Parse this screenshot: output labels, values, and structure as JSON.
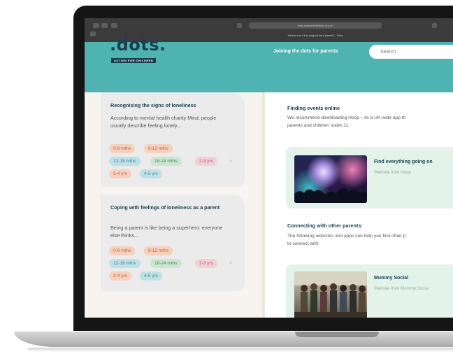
{
  "browser": {
    "url": "dots.actionforchildren.org.uk",
    "tab_title": "Where can I find support as a parent? - Dots"
  },
  "header": {
    "logo": ".dots.",
    "logo_sub": "ACTION FOR CHILDREN",
    "tagline": "Joining the dots for parents",
    "search_placeholder": "Search"
  },
  "cards": [
    {
      "title": "Recognising the signs of loneliness",
      "description": "According to mental health charity Mind, people usually describe feeling lonely...",
      "tags": [
        "0-6 mths",
        "6-12 mths",
        "12-18 mths",
        "18-24 mths",
        "2-3 yrs",
        "3-4 yrs",
        "4-5 yrs"
      ]
    },
    {
      "title": "Coping with feelings of loneliness as a parent",
      "description": "Being a parent is like being a superhero: everyone else thinks...",
      "tags": [
        "0-6 mths",
        "6-12 mths",
        "12-18 mths",
        "18-24 mths",
        "2-3 yrs",
        "3-4 yrs",
        "4-5 yrs"
      ]
    }
  ],
  "arrow_glyph": "↗",
  "sections": [
    {
      "title": "Finding events online",
      "text_line1": "We recommend downloading Hoop – its a UK-wide app th",
      "text_line2": "parents and children under 11.",
      "resource": {
        "title": "Find everything going on",
        "subtitle": "Website from Hoop"
      }
    },
    {
      "title": "Connecting with other parents:",
      "text_line1": "The following websites and apps can help you find other p",
      "text_line2": "to connect with:",
      "resource": {
        "title": "Mummy Social",
        "subtitle": "Website from Mummy Socia"
      }
    }
  ],
  "colors": {
    "header_teal": "#4fb3b1",
    "logo_navy": "#173f4f",
    "card_grey": "#ebebeb",
    "resource_green": "#e4f3e9"
  }
}
